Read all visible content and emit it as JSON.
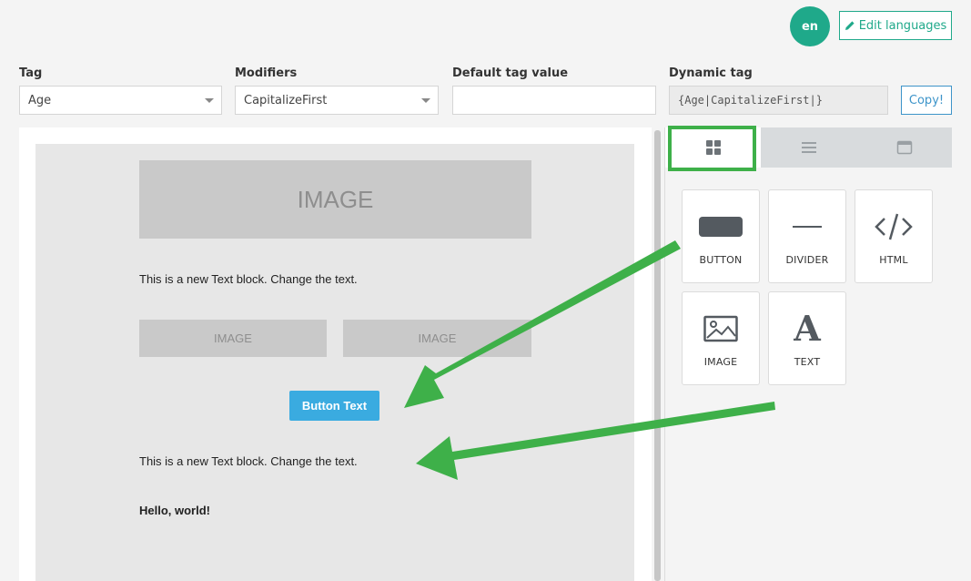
{
  "header": {
    "language_code": "en",
    "edit_languages_label": "Edit languages"
  },
  "form": {
    "tag": {
      "label": "Tag",
      "value": "Age"
    },
    "modifiers": {
      "label": "Modifiers",
      "value": "CapitalizeFirst"
    },
    "default_value": {
      "label": "Default tag value",
      "value": ""
    },
    "dynamic_tag": {
      "label": "Dynamic tag",
      "value": "{Age|CapitalizeFirst|}"
    },
    "copy_label": "Copy!"
  },
  "canvas": {
    "image_large": "IMAGE",
    "text_block_1": "This is a new Text block. Change the text.",
    "image_left": "IMAGE",
    "image_right": "IMAGE",
    "button_text": "Button Text",
    "text_block_2": "This is a new Text block. Change the text.",
    "hello_text": "Hello, world!"
  },
  "panel": {
    "tabs": [
      {
        "name": "blocks",
        "icon": "grid-icon",
        "active": true
      },
      {
        "name": "structure",
        "icon": "list-icon",
        "active": false
      },
      {
        "name": "body",
        "icon": "window-icon",
        "active": false
      }
    ],
    "blocks": [
      {
        "label": "BUTTON",
        "icon": "button-icon"
      },
      {
        "label": "DIVIDER",
        "icon": "divider-icon"
      },
      {
        "label": "HTML",
        "icon": "code-icon"
      },
      {
        "label": "IMAGE",
        "icon": "image-icon"
      },
      {
        "label": "TEXT",
        "icon": "text-icon"
      }
    ]
  },
  "colors": {
    "accent_green": "#1fa98a",
    "highlight_green": "#3eb049",
    "button_blue": "#3aabe0",
    "link_blue": "#3d94c9"
  }
}
